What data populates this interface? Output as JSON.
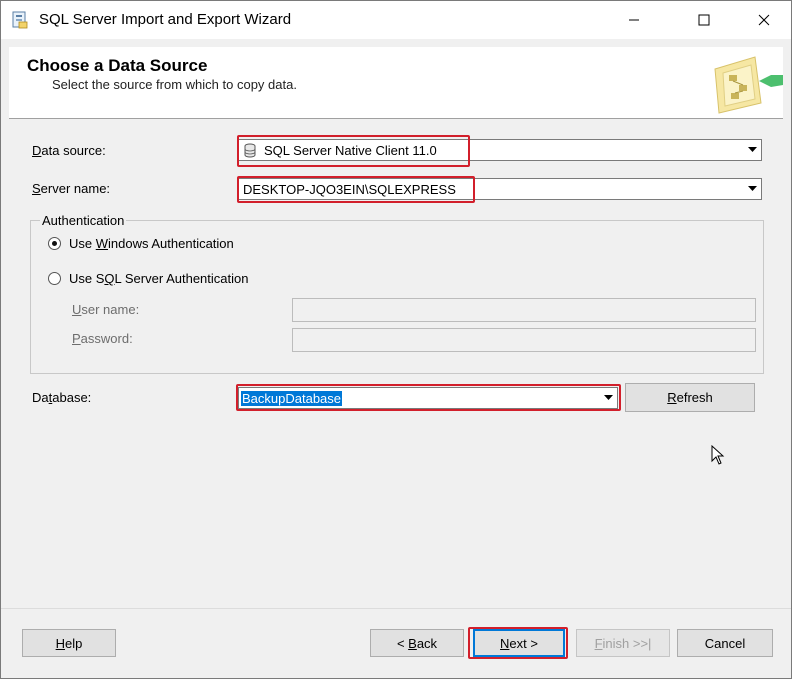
{
  "window": {
    "title": "SQL Server Import and Export Wizard"
  },
  "header": {
    "title": "Choose a Data Source",
    "subtitle": "Select the source from which to copy data."
  },
  "form": {
    "data_source": {
      "label_pre": "",
      "label_u": "D",
      "label_post": "ata source:",
      "value": "SQL Server Native Client 11.0"
    },
    "server_name": {
      "label_pre": "",
      "label_u": "S",
      "label_post": "erver name:",
      "value": "DESKTOP-JQO3EIN\\SQLEXPRESS"
    },
    "authentication": {
      "legend": "Authentication",
      "windows": {
        "pre": "Use ",
        "u": "W",
        "post": "indows Authentication",
        "selected": true
      },
      "sql": {
        "pre": "Use S",
        "u": "Q",
        "post": "L Server Authentication",
        "selected": false
      },
      "user_name": {
        "label_pre": "",
        "label_u": "U",
        "label_post": "ser name:",
        "value": ""
      },
      "password": {
        "label_pre": "",
        "label_u": "P",
        "label_post": "assword:",
        "value": ""
      }
    },
    "database": {
      "label_pre": "Da",
      "label_u": "t",
      "label_post": "abase:",
      "value": "BackupDatabase"
    },
    "refresh_button": {
      "pre": "",
      "u": "R",
      "post": "efresh"
    }
  },
  "footer": {
    "help": {
      "pre": "",
      "u": "H",
      "post": "elp"
    },
    "back": {
      "pre": "< ",
      "u": "B",
      "post": "ack"
    },
    "next": {
      "pre": "",
      "u": "N",
      "post": "ext >"
    },
    "finish": {
      "pre": "",
      "u": "F",
      "post": "inish >>|"
    },
    "cancel": {
      "pre": "Cancel",
      "u": "",
      "post": ""
    }
  },
  "colors": {
    "highlight": "#d21f2b",
    "selection": "#0078d7"
  }
}
